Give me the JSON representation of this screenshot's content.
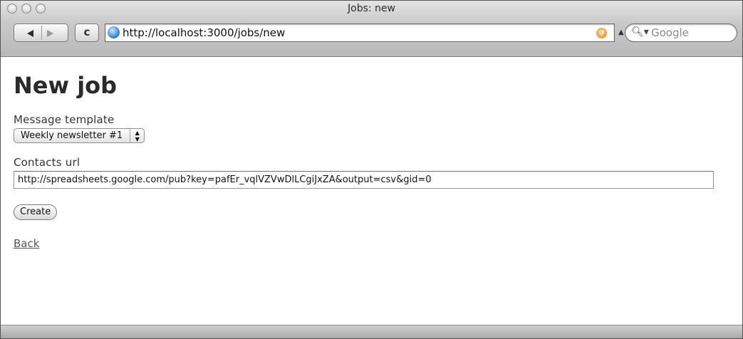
{
  "window": {
    "title": "Jobs: new"
  },
  "toolbar": {
    "reload_glyph": "c",
    "url": "http://localhost:3000/jobs/new",
    "search_placeholder": "Google"
  },
  "page": {
    "heading": "New job",
    "template_label": "Message template",
    "template_selected": "Weekly newsletter #1",
    "contacts_label": "Contacts url",
    "contacts_value": "http://spreadsheets.google.com/pub?key=pafEr_vqlVZVwDlLCgiJxZA&output=csv&gid=0",
    "create_label": "Create",
    "back_link": "Back"
  }
}
